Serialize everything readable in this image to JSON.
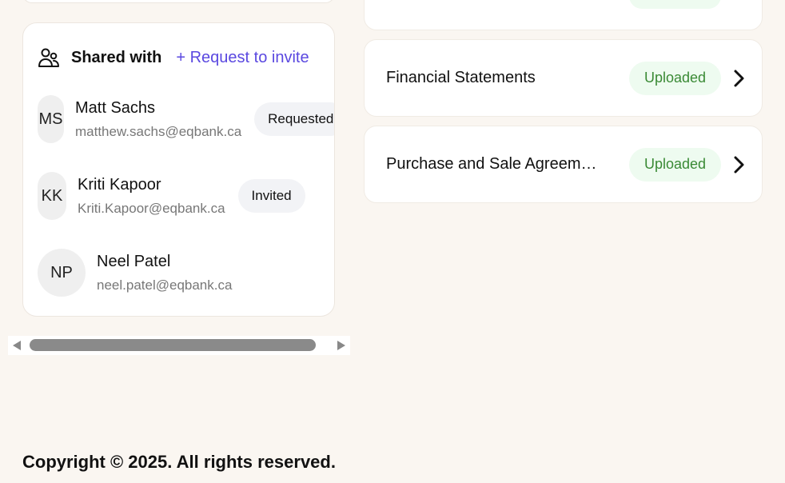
{
  "shared": {
    "title": "Shared with",
    "invite_label": "+ Request to invite",
    "people": [
      {
        "initials": "MS",
        "name": "Matt Sachs",
        "email": "matthew.sachs@eqbank.ca",
        "status": "Requested"
      },
      {
        "initials": "KK",
        "name": "Kriti Kapoor",
        "email": "Kriti.Kapoor@eqbank.ca",
        "status": "Invited"
      },
      {
        "initials": "NP",
        "name": "Neel Patel",
        "email": "neel.patel@eqbank.ca",
        "status": ""
      }
    ]
  },
  "documents": [
    {
      "title": "Financial Statements",
      "status": "Uploaded"
    },
    {
      "title": "Purchase and Sale Agreem…",
      "status": "Uploaded"
    }
  ],
  "colors": {
    "accent": "#5a48e0",
    "uploaded_text": "#3a8a35",
    "uploaded_bg": "#eefbf0",
    "background": "#faf6f1"
  },
  "footer": {
    "copyright": "Copyright © 2025. All rights reserved."
  }
}
